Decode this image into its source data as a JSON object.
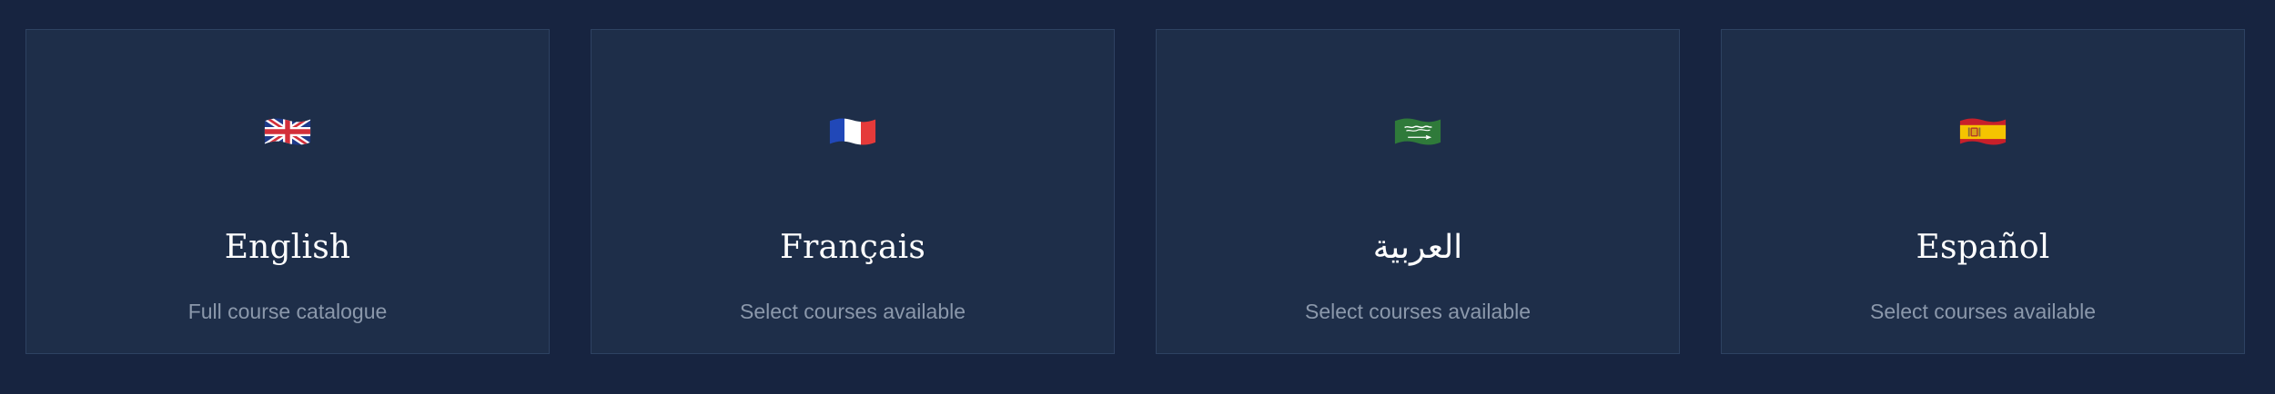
{
  "languages": [
    {
      "flag": "uk-flag-icon",
      "name": "English",
      "subtitle": "Full course catalogue"
    },
    {
      "flag": "france-flag-icon",
      "name": "Français",
      "subtitle": "Select courses available"
    },
    {
      "flag": "saudi-arabia-flag-icon",
      "name": "العربية",
      "subtitle": "Select courses available"
    },
    {
      "flag": "spain-flag-icon",
      "name": "Español",
      "subtitle": "Select courses available"
    }
  ],
  "colors": {
    "page_background": "#172440",
    "card_background": "#1e2e49",
    "card_border": "#2e4262",
    "title_text": "#ffffff",
    "subtitle_text": "#8b98ab"
  }
}
